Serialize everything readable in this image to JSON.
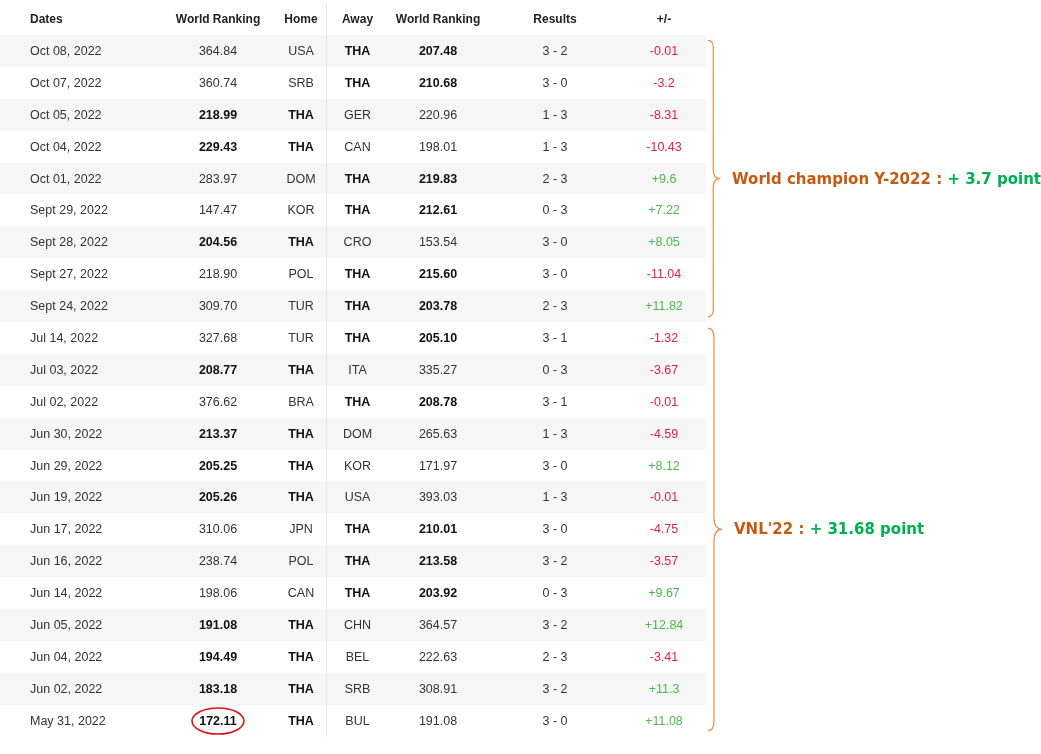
{
  "table": {
    "columns": [
      "Dates",
      "World Ranking",
      "Home",
      "Away",
      "World Ranking",
      "Results",
      "+/-"
    ]
  },
  "groups": [
    {
      "label": "World champion Y-2022 :",
      "total": "+ 3.7 point",
      "rows": [
        {
          "date": "Oct 08, 2022",
          "home_ranking": "364.84",
          "home": "USA",
          "away": "THA",
          "away_ranking": "207.48",
          "result": "3 - 2",
          "change": "-0.01",
          "home_bold": false,
          "gain": false,
          "circled": false
        },
        {
          "date": "Oct 07, 2022",
          "home_ranking": "360.74",
          "home": "SRB",
          "away": "THA",
          "away_ranking": "210.68",
          "result": "3 - 0",
          "change": "-3.2",
          "home_bold": false,
          "gain": false,
          "circled": false
        },
        {
          "date": "Oct 05, 2022",
          "home_ranking": "218.99",
          "home": "THA",
          "away": "GER",
          "away_ranking": "220.96",
          "result": "1 - 3",
          "change": "-8.31",
          "home_bold": true,
          "gain": false,
          "circled": false
        },
        {
          "date": "Oct 04, 2022",
          "home_ranking": "229.43",
          "home": "THA",
          "away": "CAN",
          "away_ranking": "198.01",
          "result": "1 - 3",
          "change": "-10.43",
          "home_bold": true,
          "gain": false,
          "circled": false
        },
        {
          "date": "Oct 01, 2022",
          "home_ranking": "283.97",
          "home": "DOM",
          "away": "THA",
          "away_ranking": "219.83",
          "result": "2 - 3",
          "change": "+9.6",
          "home_bold": false,
          "gain": true,
          "circled": false
        },
        {
          "date": "Sept 29, 2022",
          "home_ranking": "147.47",
          "home": "KOR",
          "away": "THA",
          "away_ranking": "212.61",
          "result": "0 - 3",
          "change": "+7.22",
          "home_bold": false,
          "gain": true,
          "circled": false
        },
        {
          "date": "Sept 28, 2022",
          "home_ranking": "204.56",
          "home": "THA",
          "away": "CRO",
          "away_ranking": "153.54",
          "result": "3 - 0",
          "change": "+8.05",
          "home_bold": true,
          "gain": true,
          "circled": false
        },
        {
          "date": "Sept 27, 2022",
          "home_ranking": "218.90",
          "home": "POL",
          "away": "THA",
          "away_ranking": "215.60",
          "result": "3 - 0",
          "change": "-11.04",
          "home_bold": false,
          "gain": false,
          "circled": false
        },
        {
          "date": "Sept 24, 2022",
          "home_ranking": "309.70",
          "home": "TUR",
          "away": "THA",
          "away_ranking": "203.78",
          "result": "2 - 3",
          "change": "+11.82",
          "home_bold": false,
          "gain": true,
          "circled": false
        }
      ]
    },
    {
      "label": "VNL'22 :",
      "total": "+ 31.68 point",
      "rows": [
        {
          "date": "Jul 14, 2022",
          "home_ranking": "327.68",
          "home": "TUR",
          "away": "THA",
          "away_ranking": "205.10",
          "result": "3 - 1",
          "change": "-1.32",
          "home_bold": false,
          "gain": false,
          "circled": false
        },
        {
          "date": "Jul 03, 2022",
          "home_ranking": "208.77",
          "home": "THA",
          "away": "ITA",
          "away_ranking": "335.27",
          "result": "0 - 3",
          "change": "-3.67",
          "home_bold": true,
          "gain": false,
          "circled": false
        },
        {
          "date": "Jul 02, 2022",
          "home_ranking": "376.62",
          "home": "BRA",
          "away": "THA",
          "away_ranking": "208.78",
          "result": "3 - 1",
          "change": "-0.01",
          "home_bold": false,
          "gain": false,
          "circled": false
        },
        {
          "date": "Jun 30, 2022",
          "home_ranking": "213.37",
          "home": "THA",
          "away": "DOM",
          "away_ranking": "265.63",
          "result": "1 - 3",
          "change": "-4.59",
          "home_bold": true,
          "gain": false,
          "circled": false
        },
        {
          "date": "Jun 29, 2022",
          "home_ranking": "205.25",
          "home": "THA",
          "away": "KOR",
          "away_ranking": "171.97",
          "result": "3 - 0",
          "change": "+8.12",
          "home_bold": true,
          "gain": true,
          "circled": false
        },
        {
          "date": "Jun 19, 2022",
          "home_ranking": "205.26",
          "home": "THA",
          "away": "USA",
          "away_ranking": "393.03",
          "result": "1 - 3",
          "change": "-0.01",
          "home_bold": true,
          "gain": false,
          "circled": false
        },
        {
          "date": "Jun 17, 2022",
          "home_ranking": "310.06",
          "home": "JPN",
          "away": "THA",
          "away_ranking": "210.01",
          "result": "3 - 0",
          "change": "-4.75",
          "home_bold": false,
          "gain": false,
          "circled": false
        },
        {
          "date": "Jun 16, 2022",
          "home_ranking": "238.74",
          "home": "POL",
          "away": "THA",
          "away_ranking": "213.58",
          "result": "3 - 2",
          "change": "-3.57",
          "home_bold": false,
          "gain": false,
          "circled": false
        },
        {
          "date": "Jun 14, 2022",
          "home_ranking": "198.06",
          "home": "CAN",
          "away": "THA",
          "away_ranking": "203.92",
          "result": "0 - 3",
          "change": "+9.67",
          "home_bold": false,
          "gain": true,
          "circled": false
        },
        {
          "date": "Jun 05, 2022",
          "home_ranking": "191.08",
          "home": "THA",
          "away": "CHN",
          "away_ranking": "364.57",
          "result": "3 - 2",
          "change": "+12.84",
          "home_bold": true,
          "gain": true,
          "circled": false
        },
        {
          "date": "Jun 04, 2022",
          "home_ranking": "194.49",
          "home": "THA",
          "away": "BEL",
          "away_ranking": "222.63",
          "result": "2 - 3",
          "change": "-3.41",
          "home_bold": true,
          "gain": false,
          "circled": false
        },
        {
          "date": "Jun 02, 2022",
          "home_ranking": "183.18",
          "home": "THA",
          "away": "SRB",
          "away_ranking": "308.91",
          "result": "3 - 2",
          "change": "+11.3",
          "home_bold": true,
          "gain": true,
          "circled": false
        },
        {
          "date": "May 31, 2022",
          "home_ranking": "172.11",
          "home": "THA",
          "away": "BUL",
          "away_ranking": "191.08",
          "result": "3 - 0",
          "change": "+11.08",
          "home_bold": true,
          "gain": true,
          "circled": true
        }
      ]
    }
  ]
}
